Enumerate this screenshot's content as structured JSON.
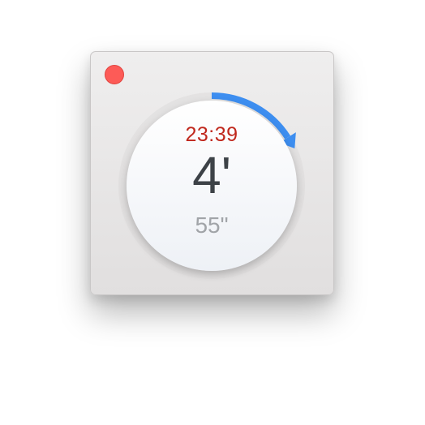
{
  "window": {
    "close_button": {
      "color": "#fd5b57"
    }
  },
  "timer": {
    "clock_time": "23:39",
    "minutes_display": "4'",
    "seconds_display": "55\"",
    "progress_fraction": 0.16,
    "colors": {
      "clock_time": "#c0271c",
      "progress_arc": "#3d8ef0",
      "track": "#dcdbdb"
    }
  }
}
